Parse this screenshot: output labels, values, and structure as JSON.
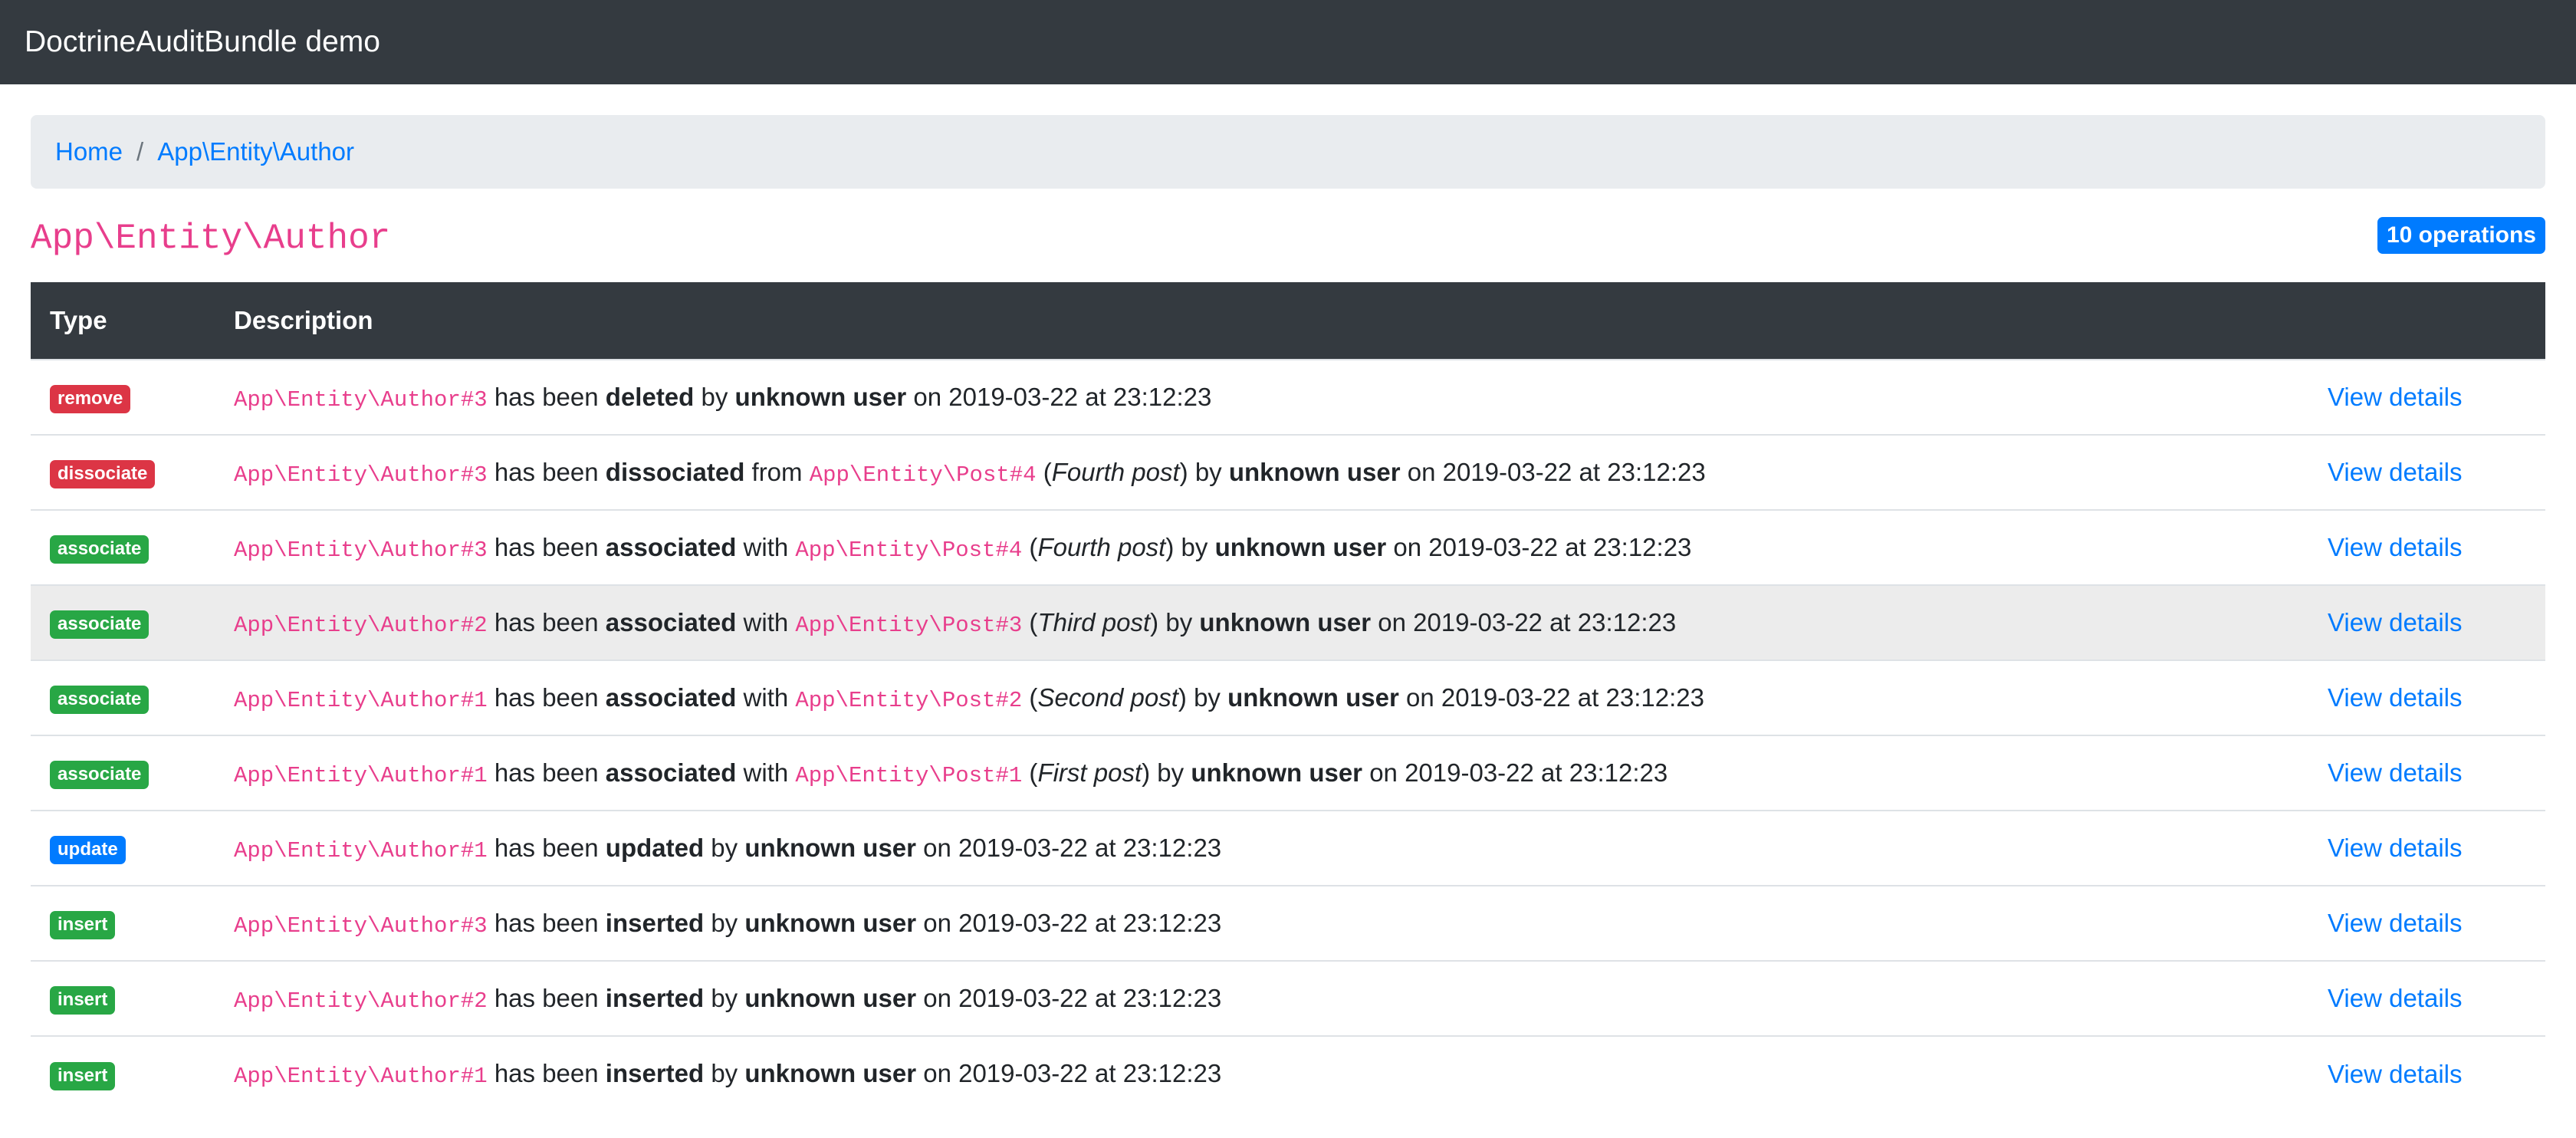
{
  "navbar": {
    "brand": "DoctrineAuditBundle demo"
  },
  "breadcrumb": {
    "home": "Home",
    "separator": "/",
    "current": "App\\Entity\\Author"
  },
  "title": "App\\Entity\\Author",
  "operations_count": "10 operations",
  "colors": {
    "remove": "#dc3545",
    "dissociate": "#dc3545",
    "associate": "#28a745",
    "update": "#007bff",
    "insert": "#28a745",
    "link": "#007bff",
    "code": "#e83e8c"
  },
  "table": {
    "headers": {
      "type": "Type",
      "description": "Description"
    },
    "rows": [
      {
        "type": "remove",
        "badge": "danger",
        "entity": "App\\Entity\\Author#3",
        "has_been": " has been ",
        "verb": "deleted",
        "by": " by ",
        "user": "unknown user",
        "on": " on 2019-03-22 at 23:12:23",
        "action": "View details"
      },
      {
        "type": "dissociate",
        "badge": "danger",
        "entity": "App\\Entity\\Author#3",
        "has_been": " has been ",
        "verb": "dissociated",
        "prep": " from ",
        "target": "App\\Entity\\Post#4",
        "open": " (",
        "label": "Fourth post",
        "close": ")",
        "by": " by ",
        "user": "unknown user",
        "on": " on 2019-03-22 at 23:12:23",
        "action": "View details"
      },
      {
        "type": "associate",
        "badge": "success",
        "entity": "App\\Entity\\Author#3",
        "has_been": " has been ",
        "verb": "associated",
        "prep": " with ",
        "target": "App\\Entity\\Post#4",
        "open": " (",
        "label": "Fourth post",
        "close": ")",
        "by": " by ",
        "user": "unknown user",
        "on": " on 2019-03-22 at 23:12:23",
        "action": "View details"
      },
      {
        "type": "associate",
        "badge": "success",
        "entity": "App\\Entity\\Author#2",
        "has_been": " has been ",
        "verb": "associated",
        "prep": " with ",
        "target": "App\\Entity\\Post#3",
        "open": " (",
        "label": "Third post",
        "close": ")",
        "by": " by ",
        "user": "unknown user",
        "on": " on 2019-03-22 at 23:12:23",
        "action": "View details"
      },
      {
        "type": "associate",
        "badge": "success",
        "entity": "App\\Entity\\Author#1",
        "has_been": " has been ",
        "verb": "associated",
        "prep": " with ",
        "target": "App\\Entity\\Post#2",
        "open": " (",
        "label": "Second post",
        "close": ")",
        "by": " by ",
        "user": "unknown user",
        "on": " on 2019-03-22 at 23:12:23",
        "action": "View details"
      },
      {
        "type": "associate",
        "badge": "success",
        "entity": "App\\Entity\\Author#1",
        "has_been": " has been ",
        "verb": "associated",
        "prep": " with ",
        "target": "App\\Entity\\Post#1",
        "open": " (",
        "label": "First post",
        "close": ")",
        "by": " by ",
        "user": "unknown user",
        "on": " on 2019-03-22 at 23:12:23",
        "action": "View details"
      },
      {
        "type": "update",
        "badge": "primary",
        "entity": "App\\Entity\\Author#1",
        "has_been": " has been ",
        "verb": "updated",
        "by": " by ",
        "user": "unknown user",
        "on": " on 2019-03-22 at 23:12:23",
        "action": "View details"
      },
      {
        "type": "insert",
        "badge": "success",
        "entity": "App\\Entity\\Author#3",
        "has_been": " has been ",
        "verb": "inserted",
        "by": " by ",
        "user": "unknown user",
        "on": " on 2019-03-22 at 23:12:23",
        "action": "View details"
      },
      {
        "type": "insert",
        "badge": "success",
        "entity": "App\\Entity\\Author#2",
        "has_been": " has been ",
        "verb": "inserted",
        "by": " by ",
        "user": "unknown user",
        "on": " on 2019-03-22 at 23:12:23",
        "action": "View details"
      },
      {
        "type": "insert",
        "badge": "success",
        "entity": "App\\Entity\\Author#1",
        "has_been": " has been ",
        "verb": "inserted",
        "by": " by ",
        "user": "unknown user",
        "on": " on 2019-03-22 at 23:12:23",
        "action": "View details"
      }
    ]
  }
}
